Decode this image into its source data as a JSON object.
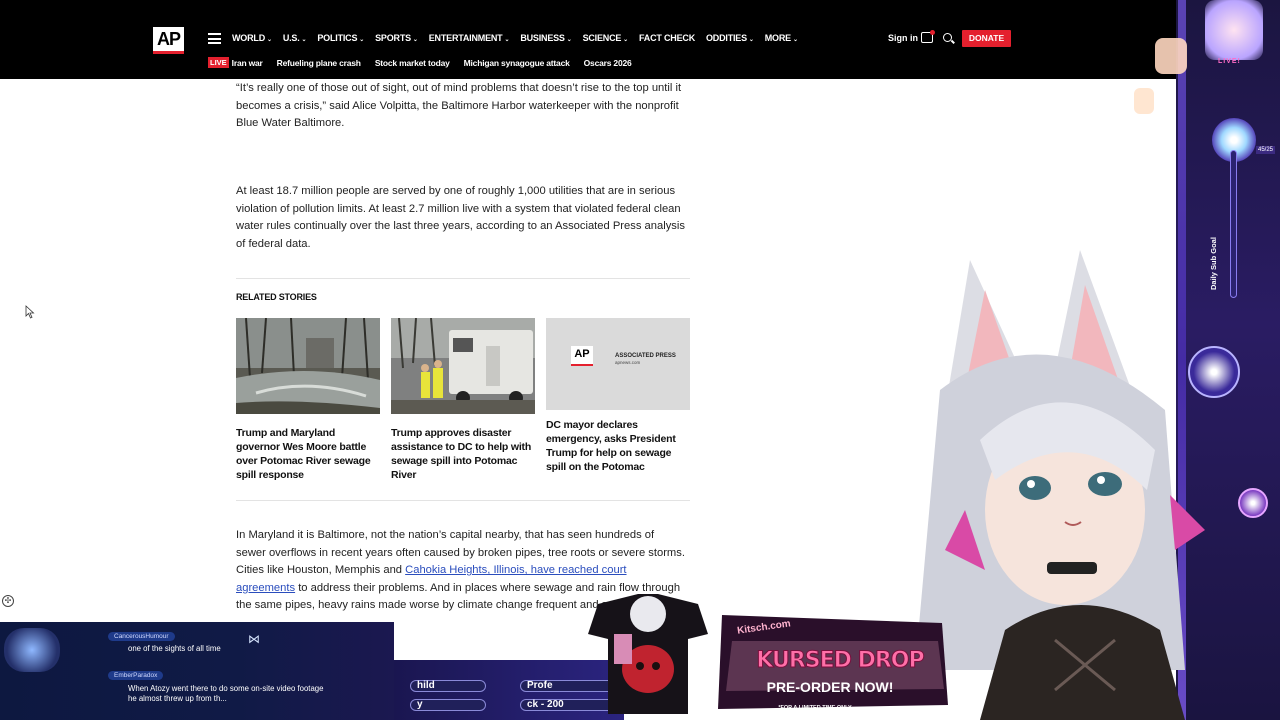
{
  "header": {
    "logo_text": "AP",
    "nav_items": [
      {
        "label": "WORLD",
        "chevron": true
      },
      {
        "label": "U.S.",
        "chevron": true
      },
      {
        "label": "POLITICS",
        "chevron": true
      },
      {
        "label": "SPORTS",
        "chevron": true
      },
      {
        "label": "ENTERTAINMENT",
        "chevron": true
      },
      {
        "label": "BUSINESS",
        "chevron": true
      },
      {
        "label": "SCIENCE",
        "chevron": true
      },
      {
        "label": "FACT CHECK",
        "chevron": false
      },
      {
        "label": "ODDITIES",
        "chevron": true
      },
      {
        "label": "MORE",
        "chevron": true
      }
    ],
    "signin_label": "Sign in",
    "donate_label": "DONATE",
    "live_badge": "LIVE",
    "trending": [
      "Iran war",
      "Refueling plane crash",
      "Stock market today",
      "Michigan synagogue attack",
      "Oscars 2026"
    ]
  },
  "article": {
    "para1": "“It’s really one of those out of sight, out of mind problems that doesn’t rise to the top until it becomes a crisis,” said Alice Volpitta, the Baltimore Harbor waterkeeper with the nonprofit Blue Water Baltimore.",
    "para2": "At least 18.7 million people are served by one of roughly 1,000 utilities that are in serious violation of pollution limits. At least 2.7 million live with a system that violated federal clean water rules continually over the last three years, according to an Associated Press analysis of federal data.",
    "related_heading": "RELATED STORIES",
    "related": [
      {
        "title": "Trump and Maryland governor Wes Moore battle over Potomac River sewage spill response"
      },
      {
        "title": "Trump approves disaster assistance to DC to help with sewage spill into Potomac River"
      },
      {
        "title": "DC mayor declares emergency, asks President Trump for help on sewage spill on the Potomac"
      }
    ],
    "placeholder_logo": "AP",
    "placeholder_text": "ASSOCIATED PRESS",
    "placeholder_sub": "apnews.com",
    "para3_start": "In Maryland it is Baltimore, not the nation’s capital nearby, that has seen hundreds of sewer overflows in recent years often caused by broken pipes, tree roots or severe storms. Cities like Houston, Memphis and ",
    "para3_link": "Cahokia Heights, Illinois, have reached court agreements",
    "para3_end": " to address their problems. And in places where sewage and rain flow through the same pipes, heavy rains made worse by climate change",
    "para3_tail": "frequent and severe."
  },
  "overlay": {
    "live_label": "LIVE!",
    "sub_goal_label": "Daily Sub Goal",
    "goal_count": "45/25",
    "goal_progress": 1.0,
    "chat": [
      {
        "user": "CancerousHumour",
        "message": "one of the sights of all time"
      },
      {
        "user": "EmberParadox",
        "message": "When Atozy went there to do some on-site video footage he almost threw up from th..."
      }
    ],
    "pill1": "hild",
    "pill2": "Profe",
    "pill3": "y",
    "pill4": "ck - 200",
    "promo_site": "Kitsch.com",
    "promo_title": "KURSED DROP",
    "promo_subtitle": "PRE-ORDER NOW!",
    "promo_note": "*FOR A LIMITED TIME ONLY"
  }
}
